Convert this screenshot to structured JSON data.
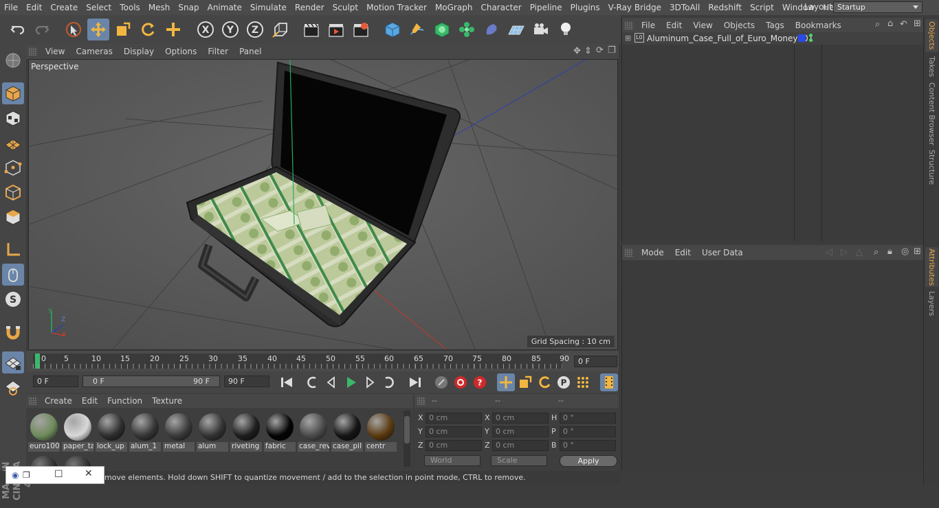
{
  "menubar": {
    "items": [
      "File",
      "Edit",
      "Create",
      "Select",
      "Tools",
      "Mesh",
      "Snap",
      "Animate",
      "Simulate",
      "Render",
      "Sculpt",
      "Motion Tracker",
      "MoGraph",
      "Character",
      "Pipeline",
      "Plugins",
      "V-Ray Bridge",
      "3DToAll",
      "Redshift",
      "Script",
      "Window",
      "Help"
    ],
    "layout_label": "Layout:",
    "layout_value": "Startup"
  },
  "viewport": {
    "menu": [
      "View",
      "Cameras",
      "Display",
      "Options",
      "Filter",
      "Panel"
    ],
    "label": "Perspective",
    "grid_spacing": "Grid Spacing : 10 cm",
    "axis_labels": {
      "x": "X",
      "y": "Y",
      "z": "Z"
    }
  },
  "timeline": {
    "ticks": [
      "0",
      "5",
      "10",
      "15",
      "20",
      "25",
      "30",
      "35",
      "40",
      "45",
      "50",
      "55",
      "60",
      "65",
      "70",
      "75",
      "80",
      "85",
      "90"
    ],
    "current_frame": "0 F"
  },
  "transport": {
    "start_field": "0 F",
    "range_start": "0 F",
    "range_end": "90 F",
    "end_field": "90 F"
  },
  "materials": {
    "menu": [
      "Create",
      "Edit",
      "Function",
      "Texture"
    ],
    "items": [
      {
        "label": "euro100",
        "color": "#6e8a5a"
      },
      {
        "label": "paper_ta",
        "color": "#d8d8d8"
      },
      {
        "label": "lock_up",
        "color": "#2e2e2e"
      },
      {
        "label": "alum_1",
        "color": "#353535"
      },
      {
        "label": "metal",
        "color": "#3a3a3a"
      },
      {
        "label": "alum",
        "color": "#333333"
      },
      {
        "label": "riveting",
        "color": "#1e1e1e"
      },
      {
        "label": "fabric",
        "color": "#050505"
      },
      {
        "label": "case_rev",
        "color": "#4a4a4a"
      },
      {
        "label": "case_pil",
        "color": "#151515"
      },
      {
        "label": "centr",
        "color": "#5a3a10"
      }
    ]
  },
  "coords": {
    "header": [
      "--",
      "--",
      "--"
    ],
    "rows": [
      {
        "l1": "X",
        "v1": "0 cm",
        "l2": "X",
        "v2": "0 cm",
        "l3": "H",
        "v3": "0 °"
      },
      {
        "l1": "Y",
        "v1": "0 cm",
        "l2": "Y",
        "v2": "0 cm",
        "l3": "P",
        "v3": "0 °"
      },
      {
        "l1": "Z",
        "v1": "0 cm",
        "l2": "Z",
        "v2": "0 cm",
        "l3": "B",
        "v3": "0 °"
      }
    ],
    "space": "World",
    "mode": "Scale",
    "apply": "Apply"
  },
  "status": {
    "text": "move elements. Hold down SHIFT to quantize movement / add to the selection in point mode, CTRL to remove."
  },
  "objects": {
    "menu": [
      "File",
      "Edit",
      "View",
      "Objects",
      "Tags",
      "Bookmarks"
    ],
    "object_name": "Aluminum_Case_Full_of_Euro_Money001",
    "layer_icon_text": "L0"
  },
  "attributes": {
    "menu": [
      "Mode",
      "Edit",
      "User Data"
    ]
  },
  "right_tabs": [
    "Objects",
    "Takes",
    "Content Browser",
    "Structure",
    "Attributes",
    "Layers"
  ],
  "colors": {
    "accent": "#6a85a8",
    "active_tab": "#e8a64a",
    "axis_x": "#c0392b",
    "axis_y": "#27ae60",
    "axis_z": "#2c3eb0"
  }
}
